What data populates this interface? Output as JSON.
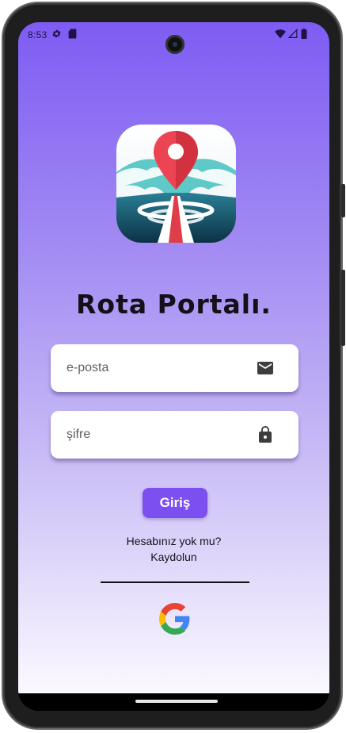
{
  "status_bar": {
    "time": "8:53",
    "left_icons": [
      "gear-icon",
      "sd-card-icon"
    ],
    "right_icons": [
      "wifi-icon",
      "signal-icon",
      "battery-icon"
    ]
  },
  "app": {
    "logo_icon": "map-pin-road-icon",
    "title": "Rota Portalı.",
    "email_placeholder": "e-posta",
    "email_icon": "mail-icon",
    "password_placeholder": "şifre",
    "password_icon": "lock-icon",
    "login_label": "Giriş",
    "signup_question": "Hesabınız yok mu?",
    "signup_link": "Kaydolun",
    "google_icon": "google-icon"
  },
  "colors": {
    "gradient_top": "#7e5cf3",
    "gradient_bottom": "#fbf9ff",
    "button": "#7b4ff0",
    "title": "#141018"
  }
}
